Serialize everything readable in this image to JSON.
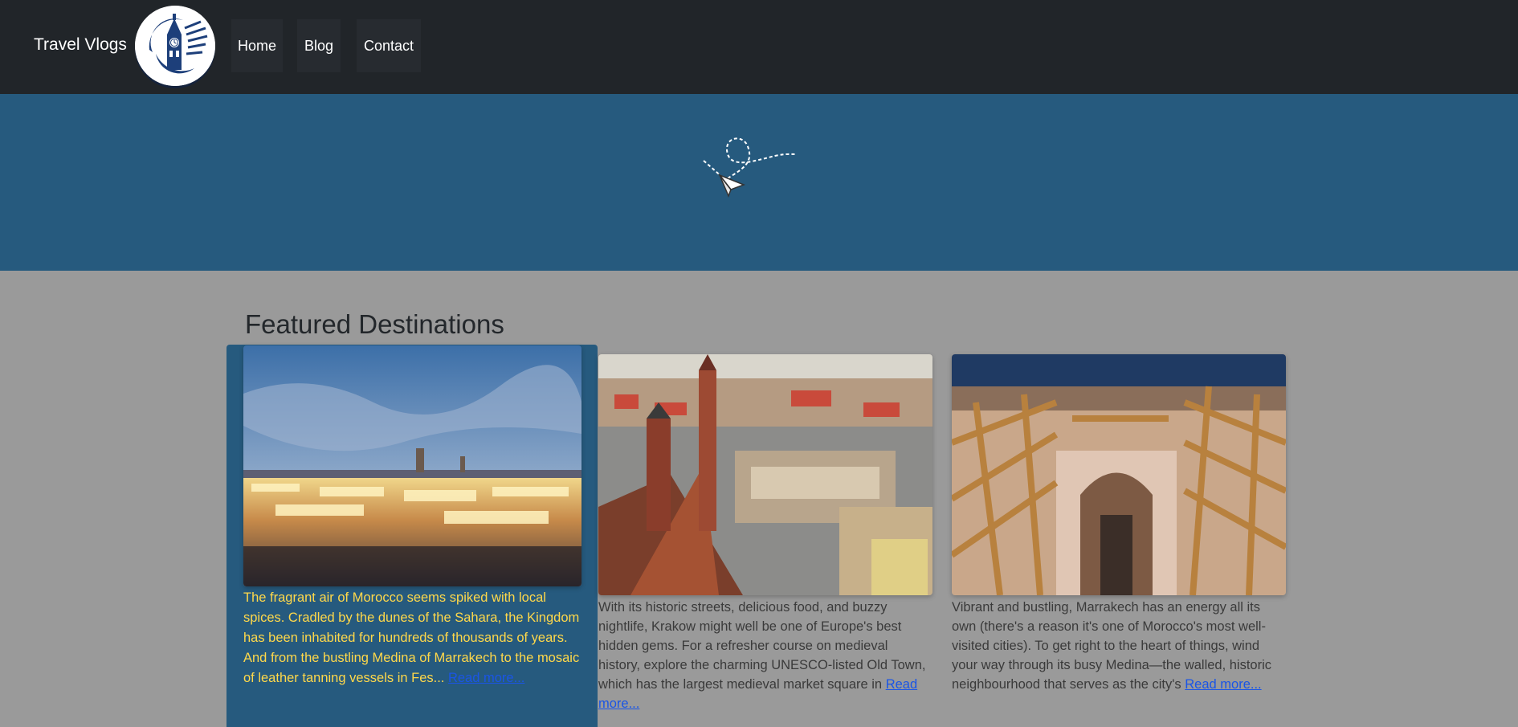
{
  "header": {
    "brand": "Travel Vlogs",
    "logo_icon": "big-ben-globe-icon",
    "nav": [
      {
        "label": "Home"
      },
      {
        "label": "Blog"
      },
      {
        "label": "Contact"
      }
    ]
  },
  "hero": {
    "icon": "paper-plane-icon"
  },
  "featured": {
    "title": "Featured Destinations",
    "cards": [
      {
        "image": "marrakech-night-market-photo",
        "text": "The fragrant air of Morocco seems spiked with local spices. Cradled by the dunes of the Sahara, the Kingdom has been inhabited for hundreds of thousands of years. And from the bustling Medina of Marrakech to the mosaic of leather tanning vessels in Fes... ",
        "link": "Read more..."
      },
      {
        "image": "krakow-old-town-photo",
        "text": "With its historic streets, delicious food, and buzzy nightlife, Krakow might well be one of Europe's best hidden gems. For a refresher course on medieval history, explore the charming UNESCO-listed Old Town, which has the largest medieval market square in ",
        "link": "Read more..."
      },
      {
        "image": "marrakech-medina-scaffolding-photo",
        "text": "Vibrant and bustling, Marrakech has an energy all its own (there's a reason it's one of Morocco's most well-visited cities). To get right to the heart of things, wind your way through its busy Medina—the walled, historic neighbourhood that serves as the city's ",
        "link": "Read more..."
      }
    ]
  },
  "colors": {
    "navbar": "#212529",
    "hero": "#265a7e",
    "page_background": "#9a9a9a",
    "highlight_text": "#ffd84a",
    "link": "#1a55e6"
  }
}
